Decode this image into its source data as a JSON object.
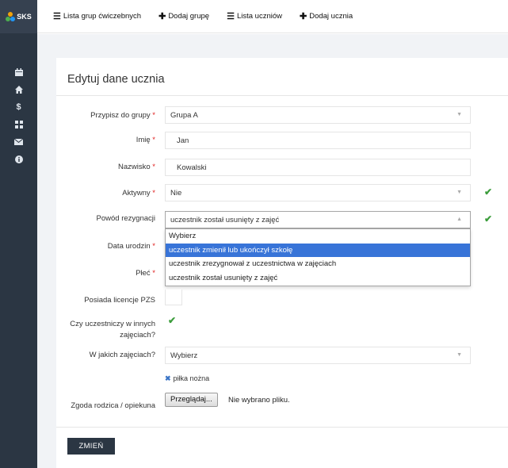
{
  "app": {
    "logo_text": "SKS"
  },
  "topnav": [
    {
      "icon": "list-icon",
      "label": "Lista grup ćwiczebnych"
    },
    {
      "icon": "plus-icon",
      "label": "Dodaj grupę"
    },
    {
      "icon": "list-icon",
      "label": "Lista uczniów"
    },
    {
      "icon": "plus-icon",
      "label": "Dodaj ucznia"
    }
  ],
  "sidebar": {
    "icons": [
      "calendar-icon",
      "home-icon",
      "dollar-icon",
      "grid-icon",
      "envelope-icon",
      "info-icon"
    ]
  },
  "form": {
    "title": "Edytuj dane ucznia",
    "required_mark": "*",
    "group": {
      "label": "Przypisz do grupy",
      "value": "Grupa A"
    },
    "first_name": {
      "label": "Imię",
      "value": "Jan"
    },
    "last_name": {
      "label": "Nazwisko",
      "value": "Kowalski"
    },
    "active": {
      "label": "Aktywny",
      "value": "Nie"
    },
    "resign_reason": {
      "label": "Powód rezygnacji",
      "value": "uczestnik został usunięty z zajęć",
      "options": [
        "Wybierz",
        "uczestnik zmienił lub ukończył szkołę",
        "uczestnik zrezygnował z uczestnictwa w zajęciach",
        "uczestnik został usunięty z zajęć"
      ],
      "highlighted_index": 1
    },
    "birth_date": {
      "label": "Data urodzin"
    },
    "gender": {
      "label": "Płeć"
    },
    "pzs_license": {
      "label": "Posiada licencje PZS"
    },
    "other_classes": {
      "label": "Czy uczestniczy w innych zajęciach?",
      "checked": true
    },
    "which_classes": {
      "label": "W jakich zajęciach?",
      "placeholder": "Wybierz",
      "tag": "piłka nożna"
    },
    "parent_consent": {
      "label": "Zgoda rodzica / opiekuna",
      "button": "Przeglądaj...",
      "file_status": "Nie wybrano pliku."
    },
    "submit_label": "ZMIEŃ"
  },
  "colors": {
    "sidebar": "#2b3643",
    "required": "#e02222",
    "check": "#3c9d3c",
    "highlight": "#3874d8"
  }
}
